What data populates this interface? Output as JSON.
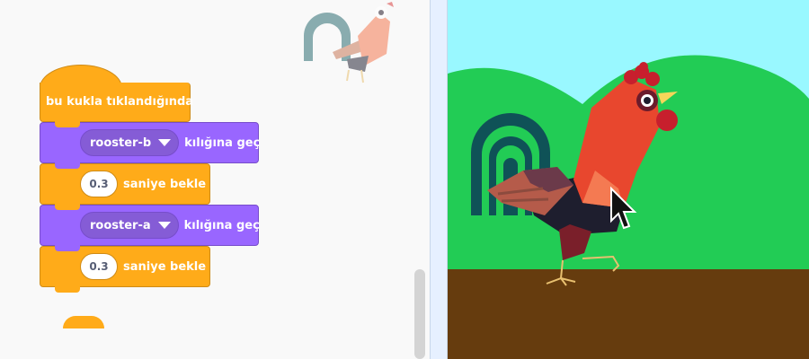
{
  "script": {
    "hat_label": "bu kukla tıklandığında",
    "blocks": [
      {
        "type": "looks",
        "costume": "rooster-b",
        "suffix": "kılığına geç"
      },
      {
        "type": "control",
        "value": "0.3",
        "suffix": "saniye bekle"
      },
      {
        "type": "looks",
        "costume": "rooster-a",
        "suffix": "kılığına geç"
      },
      {
        "type": "control",
        "value": "0.3",
        "suffix": "saniye bekle"
      }
    ]
  },
  "colors": {
    "event": "#ffab19",
    "looks": "#9966ff",
    "sky": "#99f8ff",
    "hills": "#22cc55",
    "ground": "#663c0e"
  },
  "icons": {
    "sprite_thumbnail": "rooster-icon",
    "cursor": "mouse-pointer-icon",
    "dropdown": "caret-down-icon"
  }
}
